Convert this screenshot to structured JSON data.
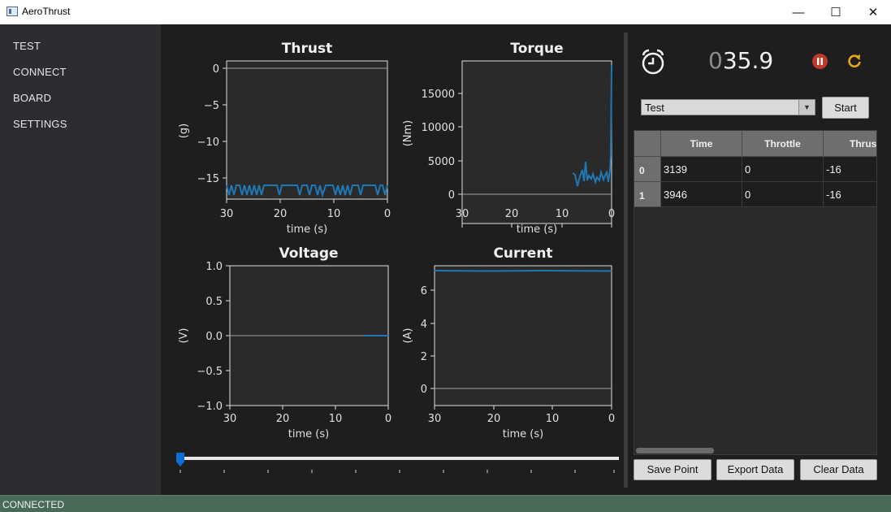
{
  "window": {
    "title": "AeroThrust",
    "min_glyph": "—",
    "max_glyph": "☐",
    "close_glyph": "✕"
  },
  "sidebar": {
    "items": [
      {
        "label": "TEST"
      },
      {
        "label": "CONNECT"
      },
      {
        "label": "BOARD"
      },
      {
        "label": "SETTINGS"
      }
    ]
  },
  "plots": [
    {
      "title": "Thrust",
      "ylabel": "(g)",
      "xlabel": "time (s)",
      "yticks": [
        "0",
        "−5",
        "−10",
        "−15"
      ],
      "xticks": [
        "30",
        "20",
        "10",
        "0"
      ]
    },
    {
      "title": "Torque",
      "ylabel": "(Nm)",
      "xlabel": "time (s)",
      "yticks": [
        "15000",
        "10000",
        "5000",
        "0"
      ],
      "xticks": [
        "30",
        "20",
        "10",
        "0"
      ]
    },
    {
      "title": "Voltage",
      "ylabel": "(V)",
      "xlabel": "time (s)",
      "yticks": [
        "1.0",
        "0.5",
        "0.0",
        "−0.5",
        "−1.0"
      ],
      "xticks": [
        "30",
        "20",
        "10",
        "0"
      ]
    },
    {
      "title": "Current",
      "ylabel": "(A)",
      "xlabel": "time (s)",
      "yticks": [
        "6",
        "4",
        "2",
        "0"
      ],
      "xticks": [
        "30",
        "20",
        "10",
        "0"
      ]
    }
  ],
  "slider": {
    "value": 0
  },
  "timer": {
    "leading": "0",
    "value": "35.9"
  },
  "controls": {
    "mode_selected": "Test",
    "start_label": "Start"
  },
  "table": {
    "columns": [
      "Time",
      "Throttle",
      "Thrust"
    ],
    "rows": [
      {
        "index": "0",
        "cells": [
          "3139",
          "0",
          "-16"
        ]
      },
      {
        "index": "1",
        "cells": [
          "3946",
          "0",
          "-16"
        ]
      }
    ]
  },
  "actions": {
    "save_label": "Save Point",
    "export_label": "Export Data",
    "clear_label": "Clear Data"
  },
  "status": {
    "text": "CONNECTED"
  },
  "colors": {
    "line": "#1f77b4",
    "pause": "#c0392b",
    "reset": "#e6a817",
    "status_bar": "#4a6a58"
  }
}
